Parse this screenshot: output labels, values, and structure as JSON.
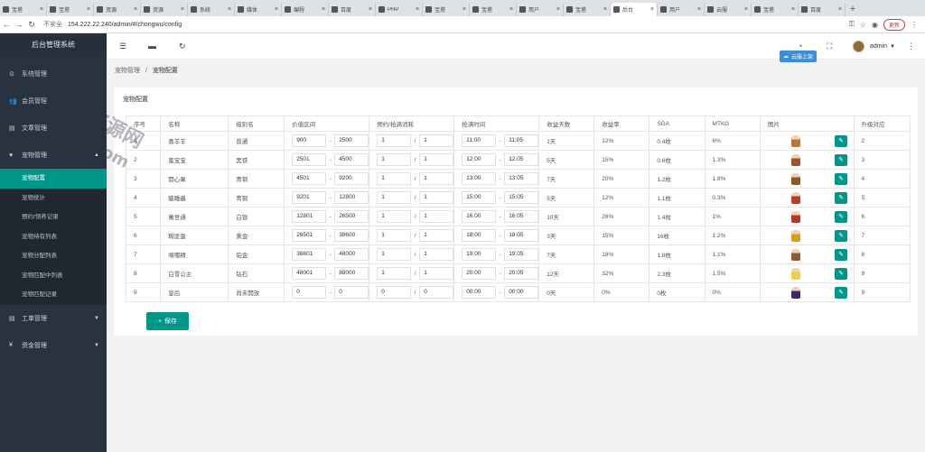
{
  "browser": {
    "tabs": [
      {
        "title": "宝塔",
        "active": false
      },
      {
        "title": "宝塔",
        "active": false
      },
      {
        "title": "资源",
        "active": false
      },
      {
        "title": "资源",
        "active": false
      },
      {
        "title": "系统",
        "active": false
      },
      {
        "title": "媒体",
        "active": false
      },
      {
        "title": "编程",
        "active": false
      },
      {
        "title": "百度",
        "active": false
      },
      {
        "title": "PHP",
        "active": false
      },
      {
        "title": "宝塔",
        "active": false
      },
      {
        "title": "宝塔",
        "active": false
      },
      {
        "title": "用户",
        "active": false
      },
      {
        "title": "宝塔",
        "active": false
      },
      {
        "title": "后台",
        "active": true
      },
      {
        "title": "用户",
        "active": false
      },
      {
        "title": "云服",
        "active": false
      },
      {
        "title": "宝塔",
        "active": false
      },
      {
        "title": "百度",
        "active": false
      }
    ],
    "new_tab": "+",
    "insecure_label": "不安全",
    "url": "154.222.22.240/admin/#/chongwu/config",
    "update_label": "更新"
  },
  "sidebar": {
    "brand": "后台管理系统",
    "menu": [
      {
        "label": "系统管理",
        "icon": "gear-icon",
        "glyph": "⚙"
      },
      {
        "label": "会员管理",
        "icon": "users-icon",
        "glyph": "👥"
      },
      {
        "label": "文章管理",
        "icon": "document-icon",
        "glyph": "▤"
      },
      {
        "label": "宠物管理",
        "icon": "heart-icon",
        "glyph": "♥"
      }
    ],
    "submenu": [
      "宠物配置",
      "宠物统计",
      "预约/领养记录",
      "宠物持有列表",
      "宠物分配列表",
      "宠物匹配中列表",
      "宠物匹配记录"
    ],
    "menu_bottom": [
      {
        "label": "工单管理",
        "icon": "ticket-icon",
        "glyph": "▤"
      },
      {
        "label": "资金管理",
        "icon": "yen-icon",
        "glyph": "¥"
      }
    ]
  },
  "topbar": {
    "user": "admin",
    "badge": "云服上架"
  },
  "breadcrumb": {
    "parent": "宠物管理",
    "current": "宠物配置"
  },
  "card": {
    "title": "宠物配置"
  },
  "table": {
    "headers": [
      "序号",
      "名称",
      "级别名",
      "价值区间",
      "预约/抢满消耗",
      "抢满时间",
      "收益天数",
      "收益率",
      "SGA",
      "MTKG",
      "图片",
      "升级对应"
    ],
    "rows": [
      {
        "id": "1",
        "name": "喜羊羊",
        "level": "普通",
        "vmin": "900",
        "vmax": "2500",
        "c1": "1",
        "c2": "1",
        "t1": "11:00",
        "t2": "11:05",
        "days": "1天",
        "rate": "12%",
        "sga": "0.4枚",
        "mtkg": "6%",
        "next": "2",
        "pet_color": "#b8743a"
      },
      {
        "id": "2",
        "name": "蜜宝宝",
        "level": "黑铁",
        "vmin": "2501",
        "vmax": "4500",
        "c1": "1",
        "c2": "1",
        "t1": "12:00",
        "t2": "12:05",
        "days": "5天",
        "rate": "15%",
        "sga": "0.6枚",
        "mtkg": "1.3%",
        "next": "3",
        "pet_color": "#a0522d"
      },
      {
        "id": "3",
        "name": "開心果",
        "level": "青铜",
        "vmin": "4501",
        "vmax": "9200",
        "c1": "1",
        "c2": "1",
        "t1": "13:00",
        "t2": "13:05",
        "days": "7天",
        "rate": "20%",
        "sga": "1.2枚",
        "mtkg": "1.8%",
        "next": "4",
        "pet_color": "#8b5a2b"
      },
      {
        "id": "4",
        "name": "瞌睡蟲",
        "level": "青铜",
        "vmin": "9201",
        "vmax": "12800",
        "c1": "1",
        "c2": "1",
        "t1": "15:00",
        "t2": "15:05",
        "days": "5天",
        "rate": "12%",
        "sga": "1.1枚",
        "mtkg": "0.3%",
        "next": "5",
        "pet_color": "#c0392b"
      },
      {
        "id": "5",
        "name": "萬世通",
        "level": "白银",
        "vmin": "12801",
        "vmax": "26500",
        "c1": "1",
        "c2": "1",
        "t1": "16:00",
        "t2": "16:05",
        "days": "10天",
        "rate": "26%",
        "sga": "1.4枚",
        "mtkg": "1%",
        "next": "6",
        "pet_color": "#b03a2e"
      },
      {
        "id": "6",
        "name": "糊塗蛋",
        "level": "黄金",
        "vmin": "26501",
        "vmax": "38600",
        "c1": "1",
        "c2": "1",
        "t1": "18:00",
        "t2": "18:05",
        "days": "3天",
        "rate": "15%",
        "sga": "16枚",
        "mtkg": "1.2%",
        "next": "7",
        "pet_color": "#d4a017"
      },
      {
        "id": "7",
        "name": "噴嚏精",
        "level": "铂金",
        "vmin": "38601",
        "vmax": "48000",
        "c1": "1",
        "c2": "1",
        "t1": "19:00",
        "t2": "19:05",
        "days": "7天",
        "rate": "18%",
        "sga": "1.8枚",
        "mtkg": "1.1%",
        "next": "8",
        "pet_color": "#8e5a3c"
      },
      {
        "id": "8",
        "name": "白雪公主",
        "level": "钻石",
        "vmin": "48001",
        "vmax": "88000",
        "c1": "1",
        "c2": "1",
        "t1": "20:00",
        "t2": "20:05",
        "days": "12天",
        "rate": "32%",
        "sga": "2.3枚",
        "mtkg": "1.5%",
        "next": "9",
        "pet_color": "#e8d24a"
      },
      {
        "id": "9",
        "name": "皇后",
        "level": "尚未開放",
        "vmin": "0",
        "vmax": "0",
        "c1": "0",
        "c2": "0",
        "t1": "00:00",
        "t2": "00:00",
        "days": "0天",
        "rate": "0%",
        "sga": "0枚",
        "mtkg": "0%",
        "next": "9",
        "pet_color": "#3a2a6e"
      }
    ]
  },
  "save_label": "保存",
  "save_icon": "+",
  "watermark": {
    "line1": "多游有综合资源网",
    "line2": "douyouvip.com"
  }
}
